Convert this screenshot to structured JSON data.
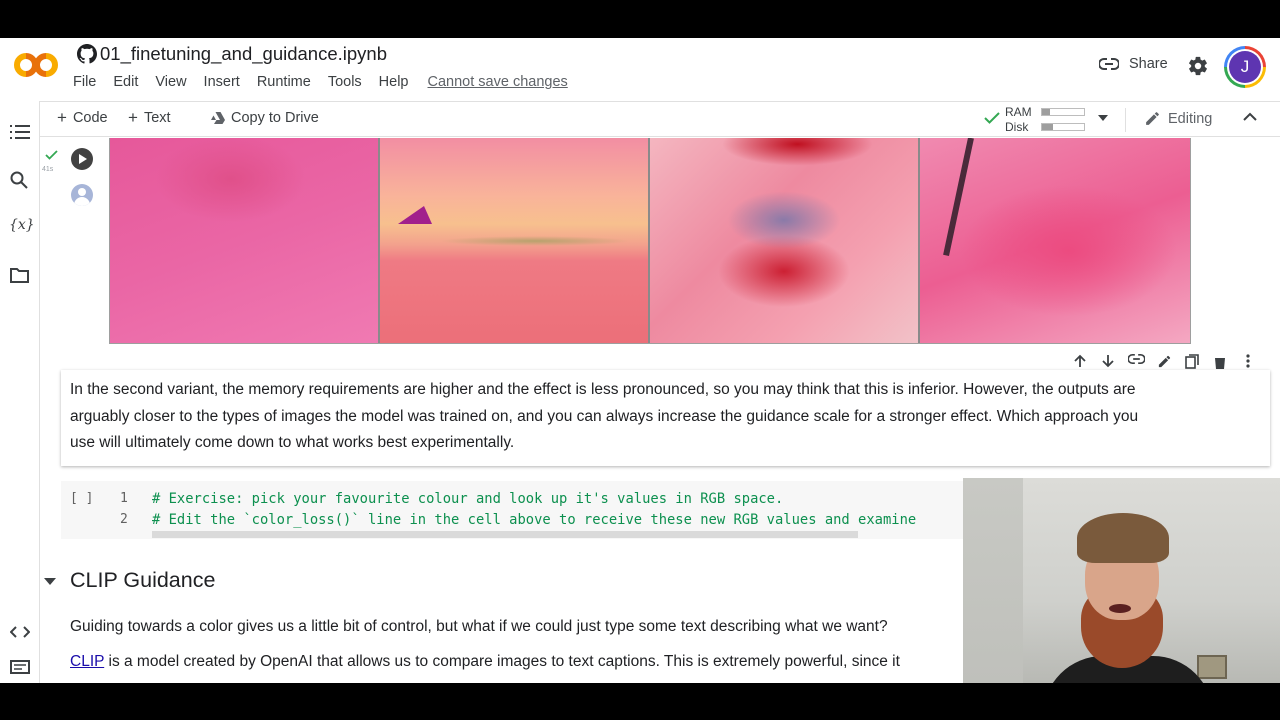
{
  "app": {
    "notebook_title": "01_finetuning_and_guidance.ipynb",
    "menu": [
      "File",
      "Edit",
      "View",
      "Insert",
      "Runtime",
      "Tools",
      "Help"
    ],
    "save_status": "Cannot save changes",
    "share_label": "Share",
    "avatar_letter": "J"
  },
  "toolbar": {
    "code_label": "Code",
    "text_label": "Text",
    "copy_label": "Copy to Drive",
    "ram_label": "RAM",
    "disk_label": "Disk",
    "ram_usage": 0.2,
    "disk_usage": 0.25,
    "editing_label": "Editing"
  },
  "cell_run": {
    "time": "41s"
  },
  "text_cell": {
    "content": "In the second variant, the memory requirements are higher and the effect is less pronounced, so you may think that this is inferior. However, the outputs are arguably closer to the types of images the model was trained on, and you can always increase the guidance scale for a stronger effect. Which approach you use will ultimately come down to what works best experimentally."
  },
  "code_cell": {
    "exec": "[ ]",
    "lines": [
      {
        "num": "1",
        "code": "# Exercise: pick your favourite colour and look up it's values in RGB space."
      },
      {
        "num": "2",
        "code": "# Edit the `color_loss()` line in the cell above to receive these new RGB values and examine"
      }
    ]
  },
  "section": {
    "title": "CLIP Guidance",
    "para1": "Guiding towards a color gives us a little bit of control, but what if we could just type some text describing what we want?",
    "para2_link": "CLIP",
    "para2_rest": " is a model created by OpenAI that allows us to compare images to text captions. This is extremely powerful, since it"
  },
  "colors": {
    "accent": "#1a73e8",
    "code_comment": "#0d904f",
    "run_ok": "#34a853"
  }
}
